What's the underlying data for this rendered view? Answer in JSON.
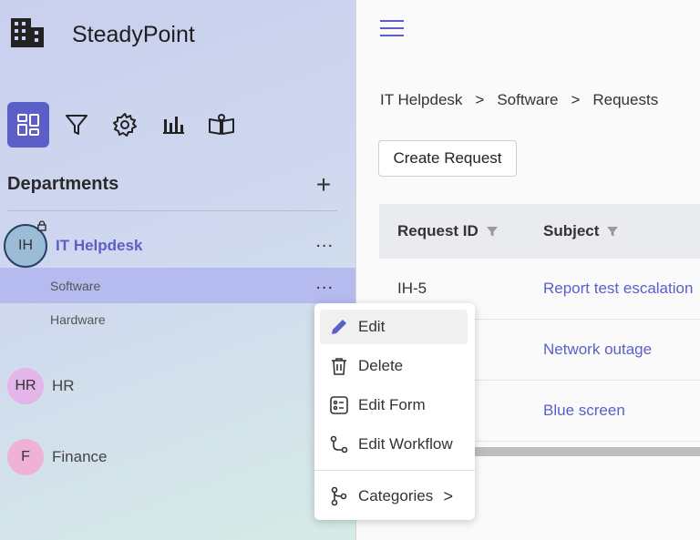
{
  "app": {
    "title": "SteadyPoint"
  },
  "sidebar": {
    "nav_icons": [
      "dashboard-icon",
      "filter-icon",
      "settings-icon",
      "reports-icon",
      "knowledge-base-icon"
    ],
    "departments_title": "Departments",
    "add_label": "+",
    "departments": [
      {
        "initials": "IH",
        "name": "IT Helpdesk",
        "more": "...",
        "subs": [
          {
            "label": "Software",
            "more": "..."
          },
          {
            "label": "Hardware"
          }
        ]
      },
      {
        "initials": "HR",
        "name": "HR"
      },
      {
        "initials": "F",
        "name": "Finance"
      }
    ]
  },
  "breadcrumb": {
    "items": [
      "IT Helpdesk",
      "Software",
      "Requests"
    ],
    "separator": ">"
  },
  "toolbar": {
    "create_label": "Create Request"
  },
  "table": {
    "columns": [
      "Request ID",
      "Subject"
    ],
    "rows": [
      {
        "id": "IH-5",
        "subject": "Report test escalation"
      },
      {
        "id": "",
        "subject": "Network outage"
      },
      {
        "id": "",
        "subject": "Blue screen"
      }
    ]
  },
  "context_menu": {
    "items": [
      {
        "label": "Edit",
        "icon": "pencil-icon"
      },
      {
        "label": "Delete",
        "icon": "trash-icon"
      },
      {
        "label": "Edit Form",
        "icon": "form-icon"
      },
      {
        "label": "Edit Workflow",
        "icon": "workflow-icon"
      },
      {
        "label": "Categories",
        "icon": "branch-icon",
        "chevron": ">"
      }
    ]
  },
  "colors": {
    "accent": "#5b5fc7",
    "selected_row": "#b5bbef"
  }
}
